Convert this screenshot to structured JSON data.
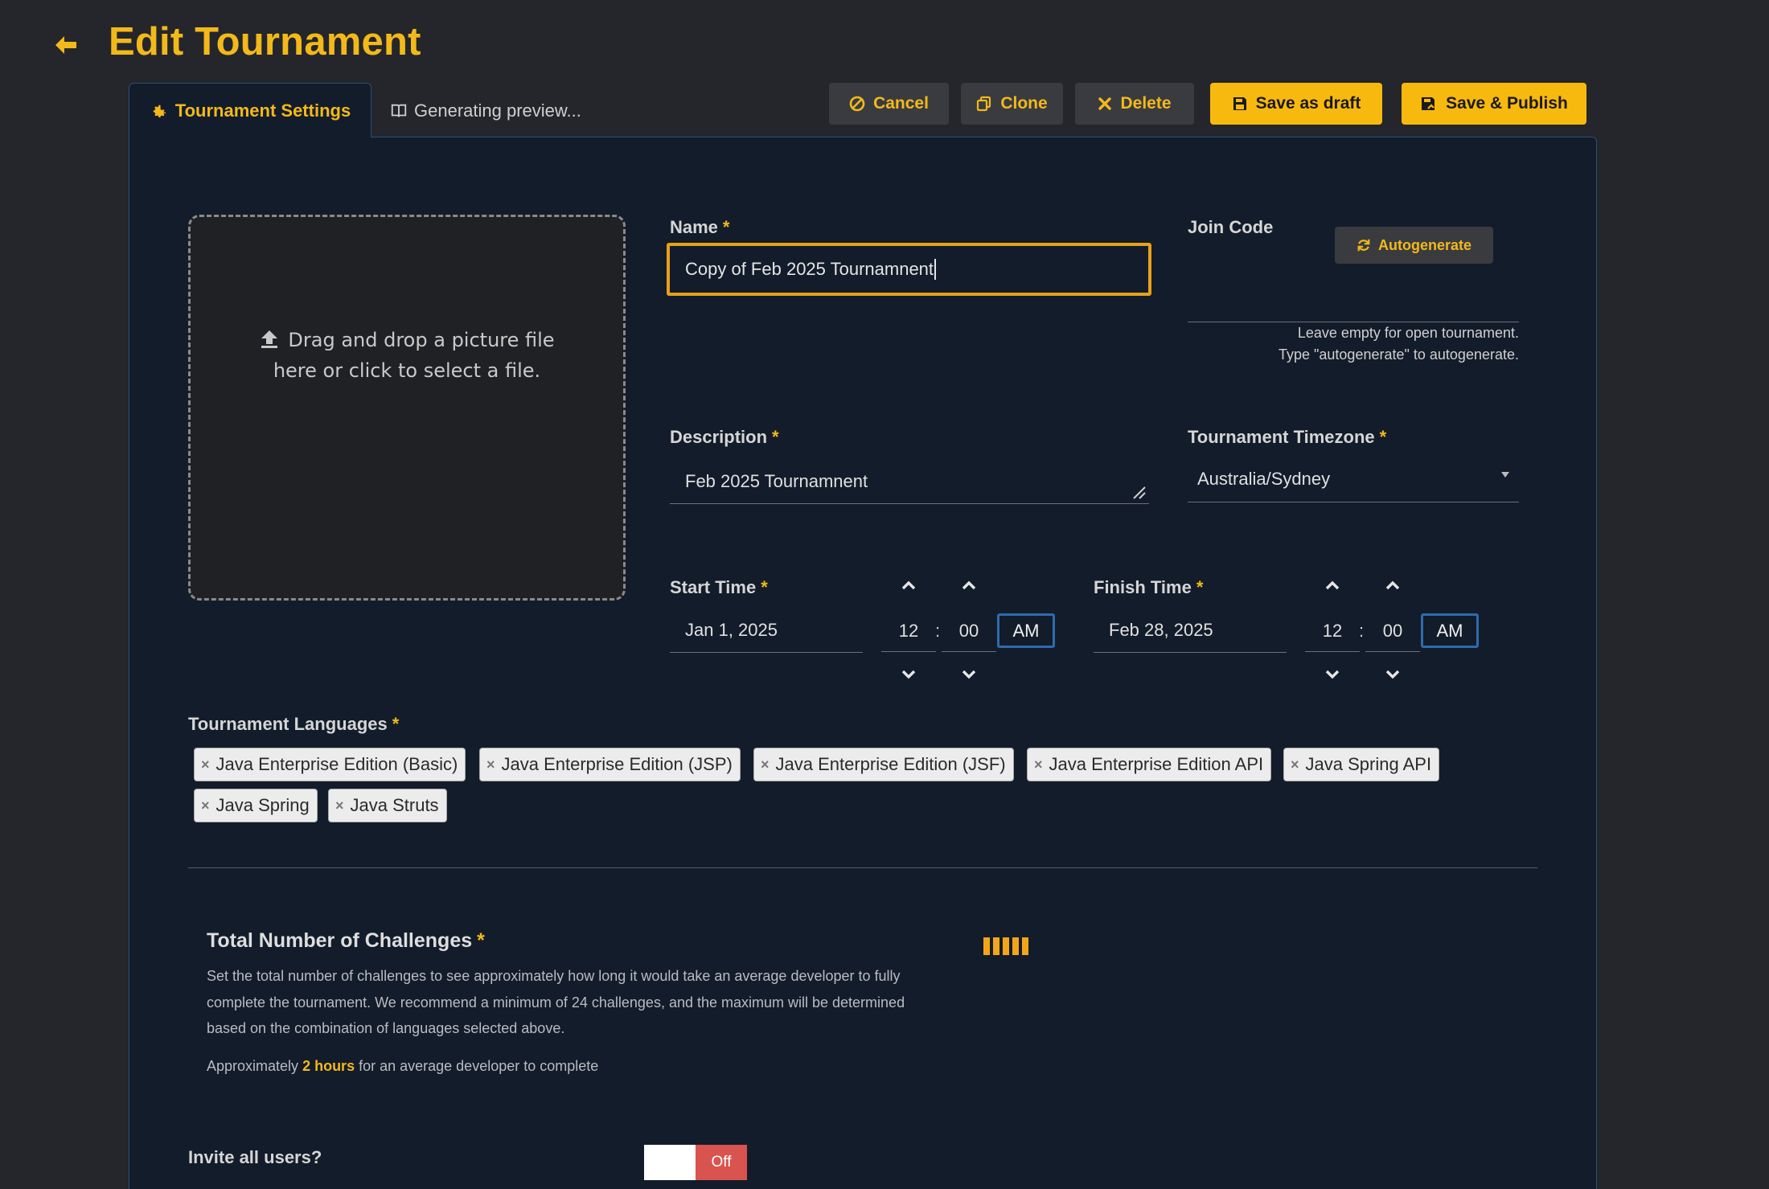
{
  "header": {
    "title": "Edit Tournament",
    "back_icon": "arrow-left-icon"
  },
  "tabs": [
    {
      "label": "Tournament Settings",
      "icon": "gear-icon",
      "active": true
    },
    {
      "label": "Generating preview...",
      "icon": "book-icon",
      "active": false
    }
  ],
  "actions": {
    "cancel": "Cancel",
    "clone": "Clone",
    "delete": "Delete",
    "save_draft": "Save as draft",
    "save_publish": "Save & Publish"
  },
  "colors": {
    "accent": "#f3b91a",
    "panel_bg": "#131c2a",
    "page_bg": "#24262b",
    "danger": "#d9534f"
  },
  "dropzone": {
    "line1": "Drag and drop a picture file",
    "line2": "here or click to select a file."
  },
  "form": {
    "required_mark": "*",
    "name": {
      "label": "Name",
      "value": "Copy of Feb 2025 Tournamnent"
    },
    "join_code": {
      "label": "Join Code",
      "value": "",
      "autogenerate_label": "Autogenerate",
      "help_line1": "Leave empty for open tournament.",
      "help_line2": "Type \"autogenerate\" to autogenerate."
    },
    "description": {
      "label": "Description",
      "value": "Feb 2025 Tournamnent"
    },
    "timezone": {
      "label": "Tournament Timezone",
      "value": "Australia/Sydney"
    },
    "start_time": {
      "label": "Start Time",
      "date": "Jan 1, 2025",
      "hour": "12",
      "minute": "00",
      "ampm": "AM"
    },
    "finish_time": {
      "label": "Finish Time",
      "date": "Feb 28, 2025",
      "hour": "12",
      "minute": "00",
      "ampm": "AM"
    },
    "time_separator": ":",
    "languages": {
      "label": "Tournament Languages",
      "items": [
        "Java Enterprise Edition (Basic)",
        "Java Enterprise Edition (JSP)",
        "Java Enterprise Edition (JSF)",
        "Java Enterprise Edition API",
        "Java Spring API",
        "Java Spring",
        "Java Struts"
      ],
      "remove_glyph": "×"
    }
  },
  "challenges": {
    "title": "Total Number of Challenges",
    "description": "Set the total number of challenges to see approximately how long it would take an average developer to fully complete the tournament. We recommend a minimum of 24 challenges, and the maximum will be determined based on the combination of languages selected above.",
    "estimate_prefix": "Approximately",
    "estimate_value": "2 hours",
    "estimate_suffix": "for an average developer to complete"
  },
  "invite": {
    "label": "Invite all users?",
    "toggle_state": "Off"
  }
}
